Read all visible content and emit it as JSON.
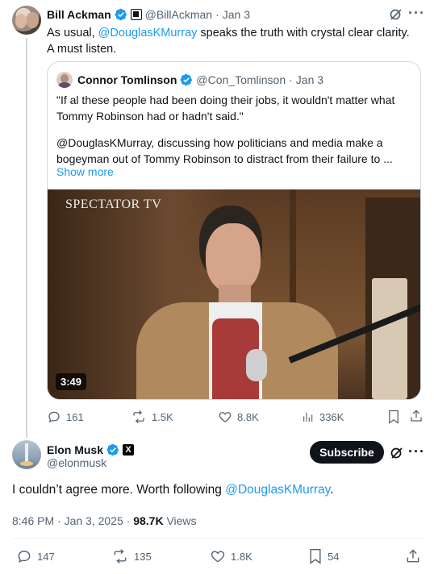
{
  "parent": {
    "name": "Bill Ackman",
    "handle": "@BillAckman",
    "date": "Jan 3",
    "text_pre": "As usual, ",
    "mention": "@DouglasKMurray",
    "text_post": " speaks the truth with crystal clear clarity. A must listen."
  },
  "quoted": {
    "name": "Connor Tomlinson",
    "handle": "@Con_Tomlinson",
    "date": "Jan 3",
    "quote": "\"If al these people had been doing their jobs, it wouldn't matter what Tommy Robinson had or hadn't said.\"",
    "body": "@DouglasKMurray, discussing how politicians and media make a bogeyman out of Tommy Robinson to distract from their failure to ...",
    "show_more": "Show more",
    "video_watermark": "SPECTATOR TV",
    "video_duration": "3:49"
  },
  "parent_stats": {
    "replies": "161",
    "reposts": "1.5K",
    "likes": "8.8K",
    "views": "336K"
  },
  "reply": {
    "name": "Elon Musk",
    "handle": "@elonmusk",
    "subscribe_label": "Subscribe",
    "text_pre": "I couldn’t agree more. Worth following ",
    "mention": "@DouglasKMurray",
    "text_post": ".",
    "timestamp": "8:46 PM · Jan 3, 2025 · ",
    "views_count": "98.7K",
    "views_label": " Views"
  },
  "reply_stats": {
    "replies": "147",
    "reposts": "135",
    "likes": "1.8K",
    "bookmarks": "54"
  },
  "colors": {
    "accent": "#1d9bf0",
    "text": "#0f1419",
    "muted": "#536471",
    "border": "#cfd9de"
  }
}
